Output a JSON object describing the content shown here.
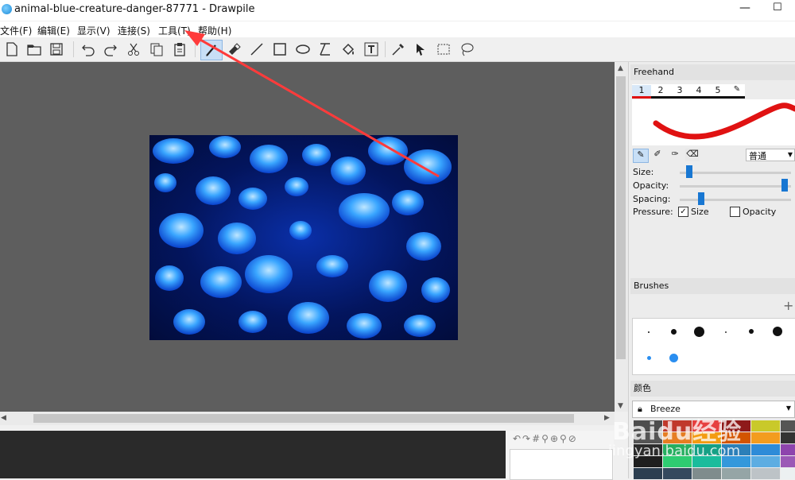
{
  "window": {
    "title": "animal-blue-creature-danger-87771 - Drawpile",
    "minimize_glyph": "—",
    "maximize_glyph": "☐"
  },
  "menu": [
    "文件(F)",
    "编辑(E)",
    "显示(V)",
    "连接(S)",
    "工具(T)",
    "帮助(H)"
  ],
  "toolbar": {
    "icons": [
      "new-file-icon",
      "open-folder-icon",
      "save-icon",
      "undo-icon",
      "redo-icon",
      "cut-icon",
      "copy-icon",
      "paste-icon",
      "freehand-brush-icon",
      "eraser-icon",
      "line-icon",
      "rectangle-icon",
      "ellipse-icon",
      "bezier-icon",
      "fill-bucket-icon",
      "text-icon",
      "color-picker-icon",
      "move-pointer-icon",
      "selection-rect-icon",
      "lasso-icon"
    ],
    "active": "freehand-brush-icon"
  },
  "annotation": {
    "color": "#ff3b3b"
  },
  "freehand": {
    "title": "Freehand",
    "presets": [
      "1",
      "2",
      "3",
      "4",
      "5"
    ],
    "selected_preset": "1",
    "blend_mode": "普通",
    "size_label": "Size:",
    "opacity_label": "Opacity:",
    "spacing_label": "Spacing:",
    "pressure_label": "Pressure:",
    "pressure_size_label": "Size",
    "pressure_size_checked": true,
    "pressure_opacity_label": "Opacity",
    "pressure_opacity_checked": false,
    "stroke_color": "#e01212"
  },
  "brushes": {
    "title": "Brushes",
    "add_glyph": "+"
  },
  "color": {
    "title": "颜色",
    "palette": "Breeze"
  },
  "watermark": {
    "brand": "Baidu经验",
    "url": "jingyan.baidu.com"
  },
  "colors": {
    "accent": "#1877d2",
    "canvas_bg": "#5e5e5e",
    "chat_bg": "#2a2a2a"
  }
}
